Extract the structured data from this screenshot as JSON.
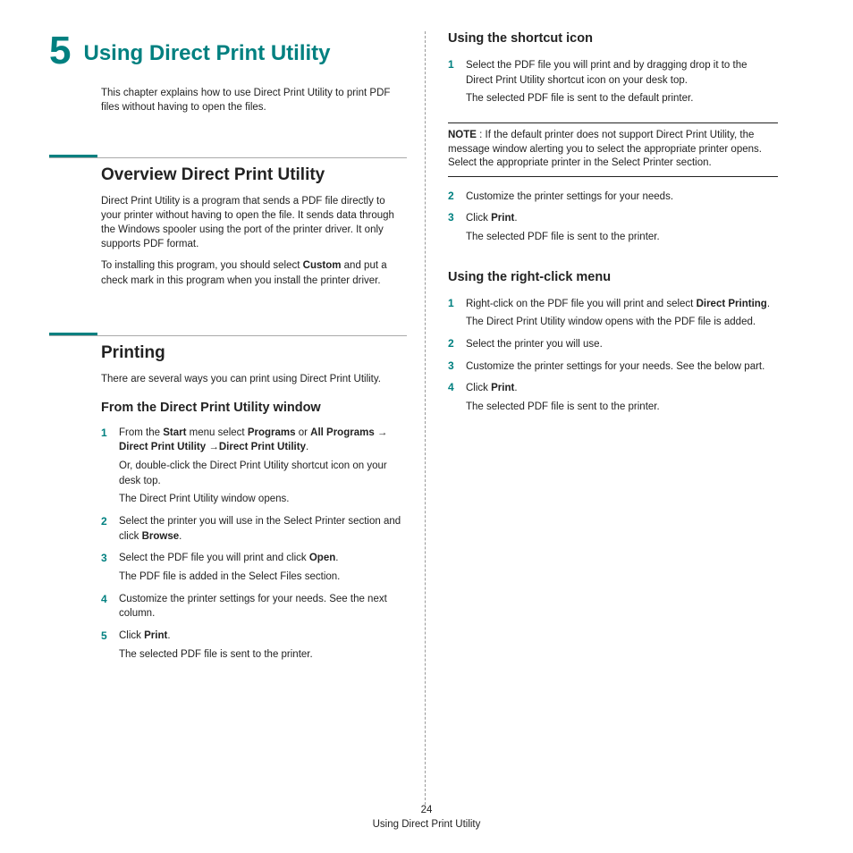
{
  "chapter": {
    "number": "5",
    "title": "Using Direct Print Utility",
    "intro": "This chapter explains how to use Direct Print Utility to print PDF files without having to open the files."
  },
  "overview": {
    "heading": "Overview Direct Print Utility",
    "p1": "Direct Print Utility is a program that sends a PDF file directly to your printer without having to open the file. It sends data through the Windows spooler using the port of the printer driver. It only supports PDF format.",
    "p2a": "To installing this program, you should select ",
    "p2b_bold": "Custom",
    "p2c": " and put a check mark in this program when you install the printer driver."
  },
  "printing": {
    "heading": "Printing",
    "intro": "There are several ways you can print using Direct Print Utility.",
    "from_window": {
      "heading": "From the Direct Print Utility window",
      "steps": [
        {
          "parts": [
            {
              "t": "From the "
            },
            {
              "t": "Start",
              "b": true
            },
            {
              "t": " menu select "
            },
            {
              "t": "Programs",
              "b": true
            },
            {
              "t": " or "
            },
            {
              "t": "All Programs",
              "b": true
            },
            {
              "t": " → "
            },
            {
              "t": "Direct Print Utility",
              "b": true
            },
            {
              "t": " →"
            },
            {
              "t": "Direct Print Utility",
              "b": true
            },
            {
              "t": "."
            }
          ],
          "after": [
            "Or, double-click the Direct Print Utility shortcut icon on your desk top.",
            "The Direct Print Utility window opens."
          ]
        },
        {
          "parts": [
            {
              "t": "Select the printer you will use in the Select Printer section and click "
            },
            {
              "t": "Browse",
              "b": true
            },
            {
              "t": "."
            }
          ]
        },
        {
          "parts": [
            {
              "t": "Select the PDF file you will print and click "
            },
            {
              "t": "Open",
              "b": true
            },
            {
              "t": "."
            }
          ],
          "after": [
            "The PDF file is added in the Select Files section."
          ]
        },
        {
          "parts": [
            {
              "t": "Customize the printer settings for your needs. See the next column."
            }
          ]
        },
        {
          "parts": [
            {
              "t": "Click "
            },
            {
              "t": "Print",
              "b": true
            },
            {
              "t": "."
            }
          ],
          "after": [
            "The selected PDF file is sent to the printer."
          ]
        }
      ]
    }
  },
  "shortcut": {
    "heading": "Using the shortcut icon",
    "step1": {
      "parts": [
        {
          "t": "Select the PDF file you will print and by dragging drop it to the Direct Print Utility shortcut icon on your desk top."
        }
      ],
      "after": [
        "The selected PDF file is sent to the default printer."
      ]
    },
    "note_label": "NOTE",
    "note_sep": " : ",
    "note_text": "If the default printer does not support Direct Print Utility, the message window alerting you to select the appropriate printer opens. Select the appropriate printer in the Select Printer section.",
    "step2": {
      "parts": [
        {
          "t": "Customize the printer settings for your needs."
        }
      ]
    },
    "step3": {
      "parts": [
        {
          "t": "Click "
        },
        {
          "t": "Print",
          "b": true
        },
        {
          "t": "."
        }
      ],
      "after": [
        "The selected PDF file is sent to the printer."
      ]
    }
  },
  "rightclick": {
    "heading": "Using the right-click menu",
    "steps": [
      {
        "parts": [
          {
            "t": "Right-click on the PDF file you will print and select "
          },
          {
            "t": "Direct Printing",
            "b": true
          },
          {
            "t": "."
          }
        ],
        "after": [
          "The Direct Print Utility window opens with the PDF file is added."
        ]
      },
      {
        "parts": [
          {
            "t": "Select the printer you will use."
          }
        ]
      },
      {
        "parts": [
          {
            "t": "Customize the printer settings for your needs. See the below part."
          }
        ]
      },
      {
        "parts": [
          {
            "t": "Click "
          },
          {
            "t": "Print",
            "b": true
          },
          {
            "t": "."
          }
        ],
        "after": [
          "The selected PDF file is sent to the printer."
        ]
      }
    ]
  },
  "footer": {
    "page": "24",
    "title": "Using Direct Print Utility"
  }
}
